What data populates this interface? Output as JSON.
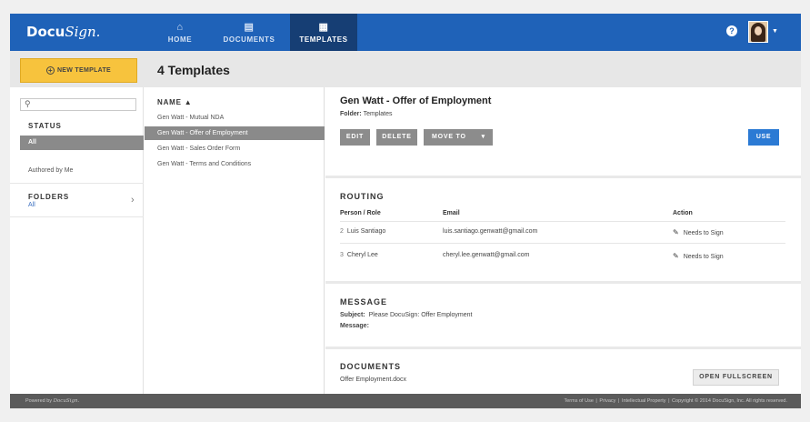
{
  "nav": {
    "logo_main": "Docu",
    "logo_script": "Sign.",
    "tabs": [
      {
        "label": "HOME",
        "icon": "home-icon"
      },
      {
        "label": "DOCUMENTS",
        "icon": "documents-icon"
      },
      {
        "label": "TEMPLATES",
        "icon": "templates-icon"
      }
    ],
    "help_symbol": "?",
    "accent_color": "#1f62b8"
  },
  "header": {
    "new_template_label": "NEW TEMPLATE",
    "page_title": "4 Templates"
  },
  "sidebar": {
    "search_placeholder": "",
    "status_heading": "STATUS",
    "status_items": [
      "All",
      "Authored by Me"
    ],
    "folders_heading": "FOLDERS",
    "folders_value": "All"
  },
  "list": {
    "column_header": "NAME ▲",
    "items": [
      "Gen Watt - Mutual NDA",
      "Gen Watt - Offer of Employment",
      "Gen Watt - Sales Order Form",
      "Gen Watt - Terms and Conditions"
    ],
    "selected_index": 1
  },
  "detail": {
    "title": "Gen Watt - Offer of Employment",
    "folder_label": "Folder:",
    "folder_value": "Templates",
    "buttons": {
      "edit": "EDIT",
      "delete": "DELETE",
      "move_to": "MOVE TO",
      "use": "USE"
    },
    "routing": {
      "heading": "ROUTING",
      "columns": [
        "Person / Role",
        "Email",
        "Action"
      ],
      "rows": [
        {
          "order": "2",
          "name": "Luis Santiago",
          "email": "luis.santiago.genwatt@gmail.com",
          "action": "Needs to Sign"
        },
        {
          "order": "3",
          "name": "Cheryl Lee",
          "email": "cheryl.lee.genwatt@gmail.com",
          "action": "Needs to Sign"
        }
      ]
    },
    "message": {
      "heading": "MESSAGE",
      "subject_label": "Subject:",
      "subject_value": "Please DocuSign: Offer Employment",
      "message_label": "Message:"
    },
    "documents": {
      "heading": "DOCUMENTS",
      "file": "Offer Employment.docx",
      "open_button": "OPEN FULLSCREEN"
    }
  },
  "footer": {
    "powered_by": "Powered by",
    "powered_brand": "DocuSign.",
    "links": [
      "Terms of Use",
      "Privacy",
      "Intellectual Property",
      "Copyright © 2014 DocuSign, Inc. All rights reserved."
    ]
  }
}
